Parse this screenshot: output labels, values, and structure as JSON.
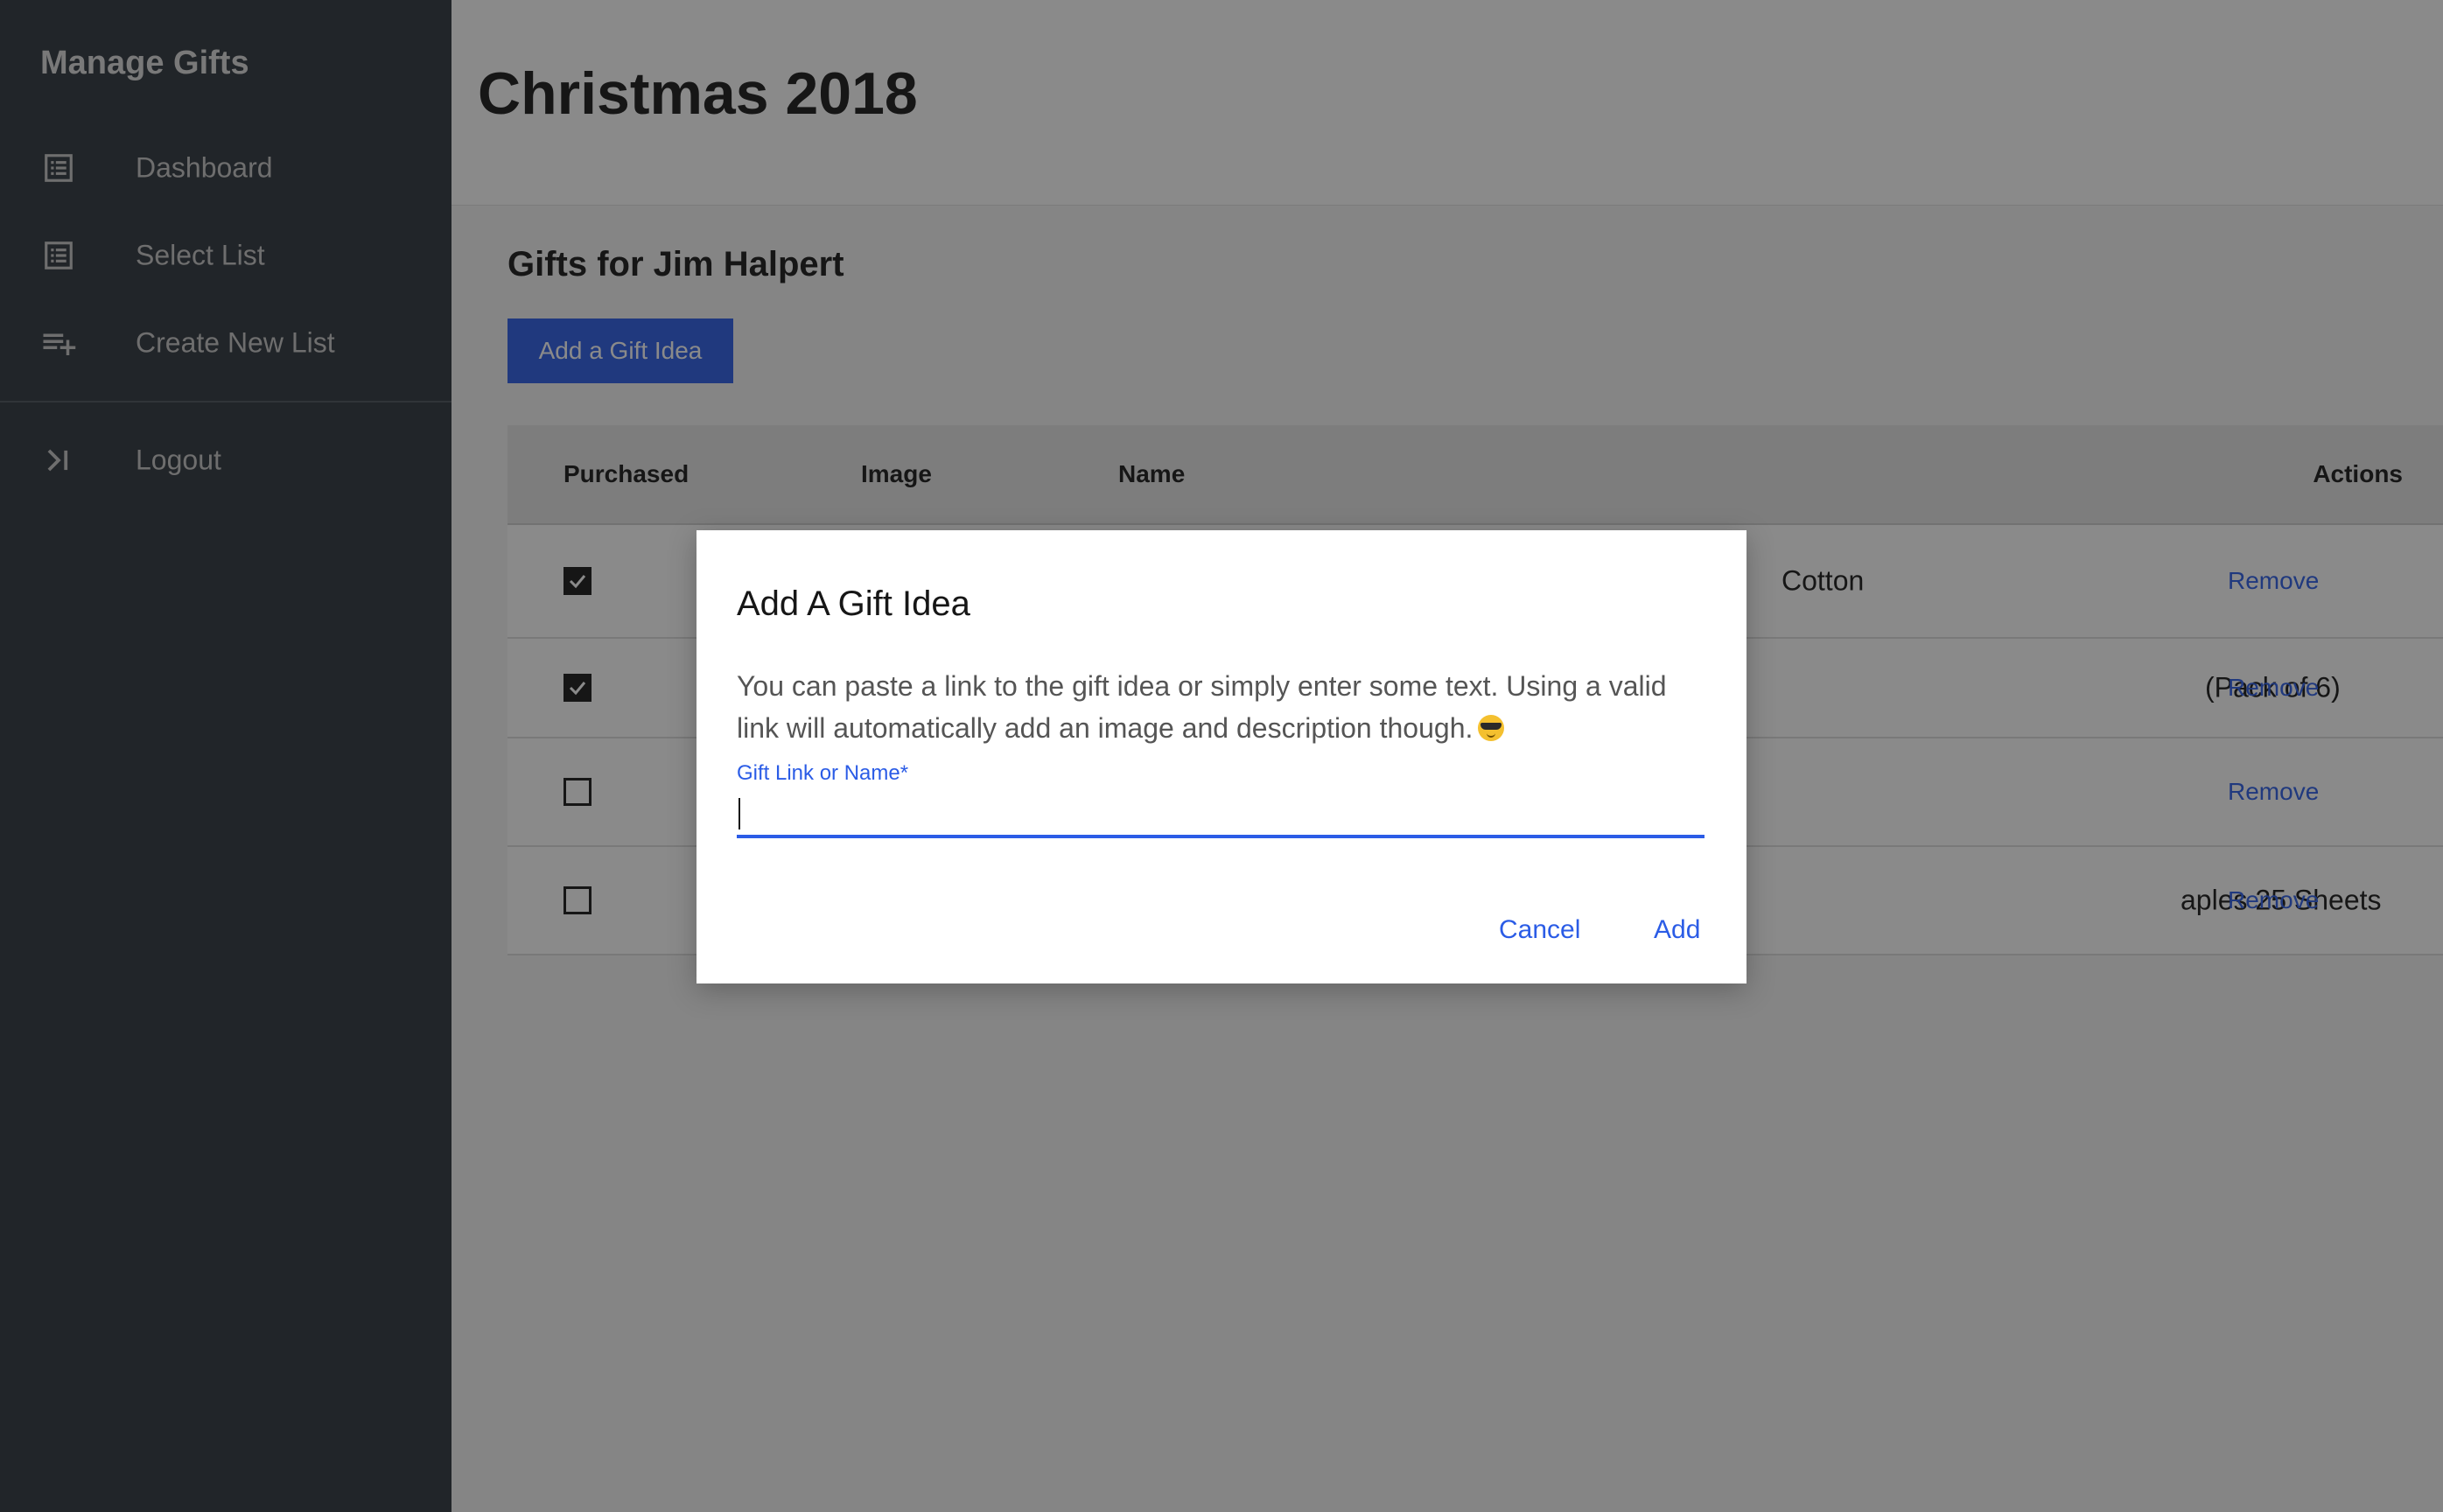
{
  "app": {
    "title": "Manage Gifts"
  },
  "sidebar": {
    "items": [
      {
        "label": "Dashboard",
        "icon": "list-icon"
      },
      {
        "label": "Select List",
        "icon": "list-icon"
      },
      {
        "label": "Create New List",
        "icon": "playlist-add-icon"
      },
      {
        "label": "Logout",
        "icon": "logout-icon"
      }
    ]
  },
  "page": {
    "title": "Christmas 2018",
    "section_title": "Gifts for Jim Halpert",
    "add_button_label": "Add a Gift Idea"
  },
  "table": {
    "headers": {
      "purchased": "Purchased",
      "image": "Image",
      "name": "Name",
      "actions": "Actions"
    },
    "rows": [
      {
        "purchased": true,
        "name_visible": "Cotton",
        "action": "Remove"
      },
      {
        "purchased": true,
        "name_visible": "(Pack of 6)",
        "action": "Remove"
      },
      {
        "purchased": false,
        "name_visible": "",
        "action": "Remove"
      },
      {
        "purchased": false,
        "name_visible": "aples 25 Sheets",
        "action": "Remove"
      }
    ]
  },
  "modal": {
    "title": "Add A Gift Idea",
    "description": "You can paste a link to the gift idea or simply enter some text. Using a valid link will automatically add an image and description though.",
    "emoji": "smiling-face-with-sunglasses",
    "field_label": "Gift Link or Name*",
    "field_value": "",
    "cancel_label": "Cancel",
    "add_label": "Add"
  },
  "colors": {
    "sidebar_bg": "#2d343c",
    "accent": "#2b5ce6",
    "overlay": "rgba(22,22,22,0.5)"
  }
}
